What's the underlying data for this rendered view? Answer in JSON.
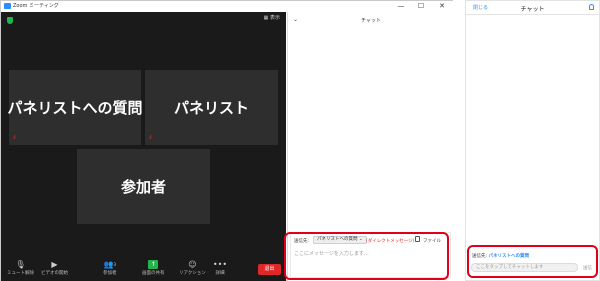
{
  "window": {
    "title": "Zoom ミーティング",
    "minimize_glyph": "—",
    "maximize_glyph": "☐",
    "close_glyph": "✕"
  },
  "video": {
    "view_button_label": "表示",
    "tiles": [
      {
        "name": "パネリストへの質問"
      },
      {
        "name": "パネリスト"
      },
      {
        "name": "参加者"
      }
    ],
    "muted_glyph": "⚡"
  },
  "toolbar": {
    "items": [
      {
        "icon": "microphone-icon",
        "label": "ミュート解除",
        "glyph": "🎙"
      },
      {
        "icon": "video-camera-icon",
        "label": "ビデオの開始",
        "glyph": "▶"
      },
      {
        "icon": "participants-icon",
        "label": "参加者",
        "glyph": "👥",
        "badge": "3"
      },
      {
        "icon": "share-screen-icon",
        "label": "画面の共有",
        "glyph": "↑"
      },
      {
        "icon": "reaction-icon",
        "label": "リアクション",
        "glyph": "☺"
      },
      {
        "icon": "more-icon",
        "label": "詳細",
        "glyph": "•••"
      }
    ],
    "leave_label": "退出"
  },
  "chat": {
    "title": "チャット",
    "collapse_glyph": "⌄",
    "send_to_label": "送信先:",
    "recipient": "パネリストへの質問 ⌄",
    "direct_message_tag": "(ダイレクトメッセージ)",
    "file_label": "ファイル",
    "message_placeholder": "ここにメッセージを入力します..."
  },
  "mobile": {
    "close_label": "閉じる",
    "title": "チャット",
    "send_to_label": "送信先:",
    "recipient": "パネリストへの質問",
    "input_placeholder": "ここをタップしてチャットします",
    "send_label": "送信"
  },
  "colors": {
    "accent": "#2d8cff",
    "leave": "#e02828",
    "highlight": "#e0001b",
    "share": "#23b54b"
  }
}
